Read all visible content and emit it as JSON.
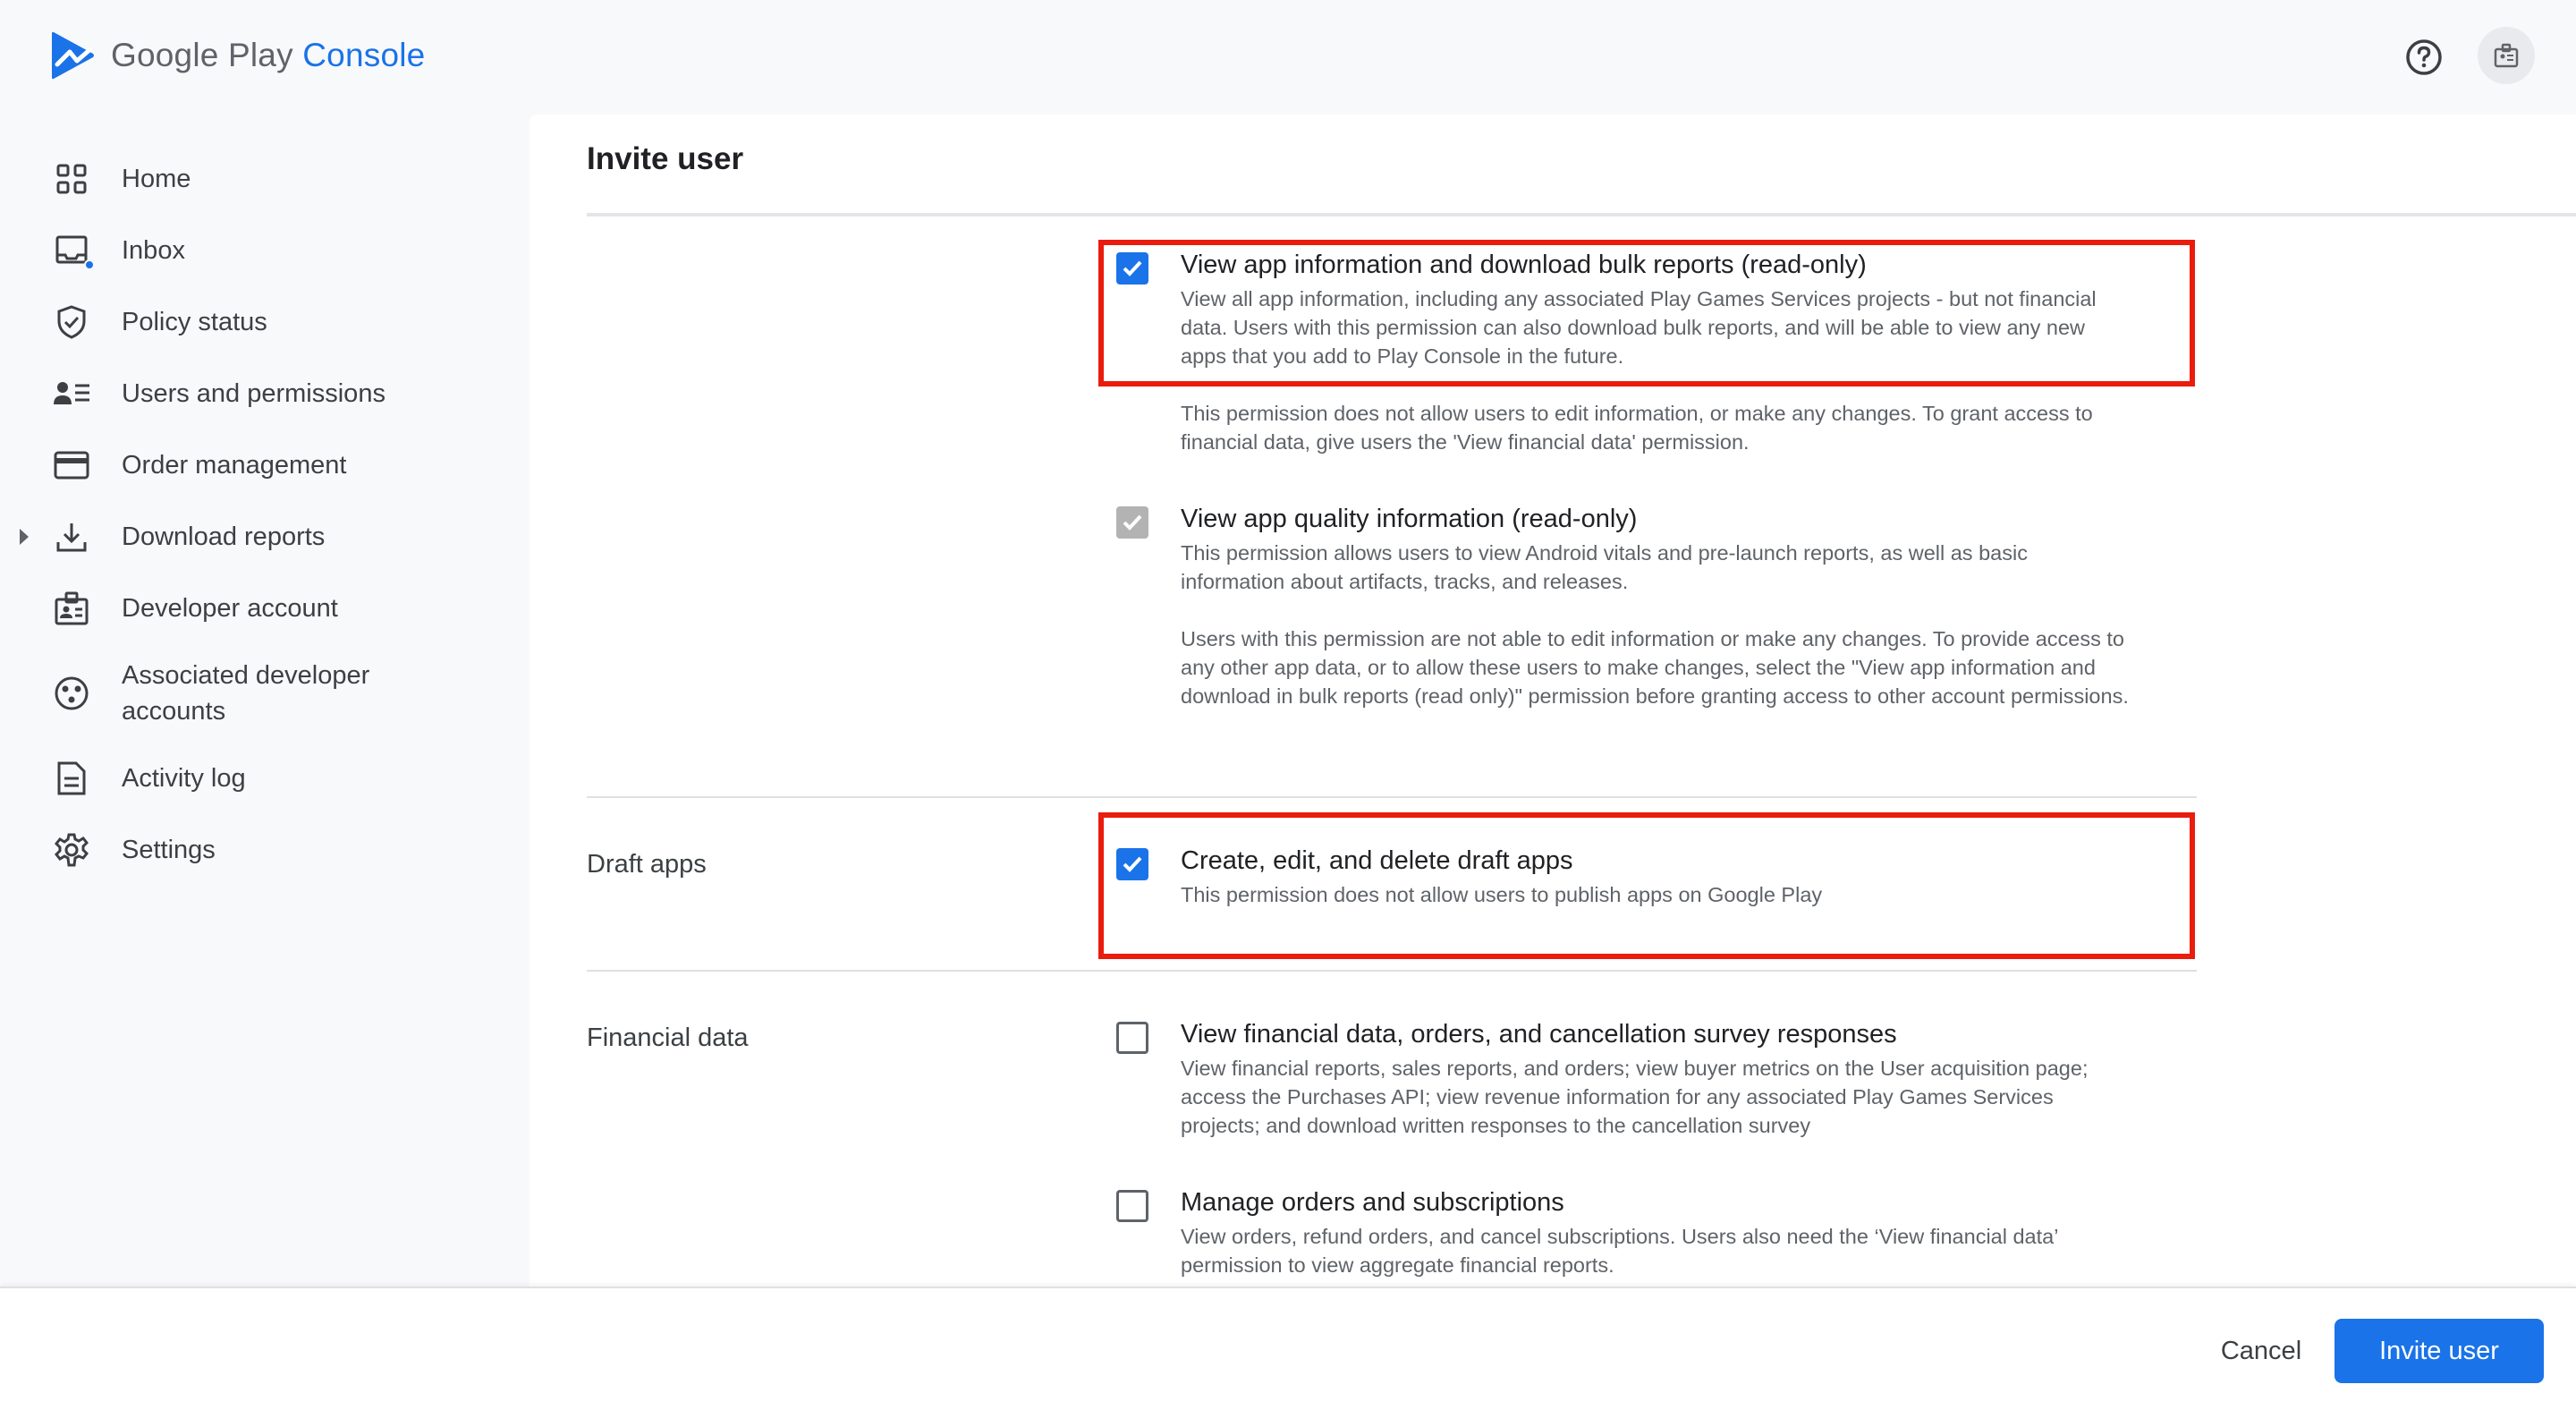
{
  "header": {
    "logo_primary": "Google Play",
    "logo_secondary": "Console",
    "help_icon": "help-circle-icon",
    "account_icon": "developer-badge-icon"
  },
  "sidebar": {
    "items": [
      {
        "label": "Home",
        "icon": "grid-icon"
      },
      {
        "label": "Inbox",
        "icon": "inbox-icon"
      },
      {
        "label": "Policy status",
        "icon": "shield-check-icon"
      },
      {
        "label": "Users and permissions",
        "icon": "users-list-icon"
      },
      {
        "label": "Order management",
        "icon": "credit-card-icon"
      },
      {
        "label": "Download reports",
        "icon": "download-icon"
      },
      {
        "label": "Developer account",
        "icon": "id-badge-icon"
      },
      {
        "label": "Associated developer accounts",
        "icon": "linked-accounts-icon"
      },
      {
        "label": "Activity log",
        "icon": "document-icon"
      },
      {
        "label": "Settings",
        "icon": "gear-icon"
      }
    ]
  },
  "main": {
    "title": "Invite user",
    "sections": {
      "draft_apps": "Draft apps",
      "financial_data": "Financial data"
    },
    "permissions": {
      "view_app_info": {
        "title": "View app information and download bulk reports (read-only)",
        "desc": "View all app information, including any associated Play Games Services projects - but not financial data. Users with this permission can also download bulk reports, and will be able to view any new apps that you add to Play Console in the future.",
        "note": "This permission does not allow users to edit information, or make any changes. To grant access to financial data, give users the 'View financial data' permission.",
        "checked": true
      },
      "view_quality": {
        "title": "View app quality information (read-only)",
        "desc": "This permission allows users to view Android vitals and pre-launch reports, as well as basic information about artifacts, tracks, and releases.",
        "note": "Users with this permission are not able to edit information or make any changes. To provide access to any other app data, or to allow these users to make changes, select the \"View app information and download in bulk reports (read only)\" permission before granting access to other account permissions.",
        "checked": true,
        "disabled": true
      },
      "draft_apps": {
        "title": "Create, edit, and delete draft apps",
        "desc": "This permission does not allow users to publish apps on Google Play",
        "checked": true
      },
      "financial": {
        "title": "View financial data, orders, and cancellation survey responses",
        "desc": "View financial reports, sales reports, and orders; view buyer metrics on the User acquisition page; access the Purchases API; view revenue information for any associated Play Games Services projects; and download written responses to the cancellation survey",
        "checked": false
      },
      "orders": {
        "title": "Manage orders and subscriptions",
        "desc": "View orders, refund orders, and cancel subscriptions. Users also need the ‘View financial data’ permission to view aggregate financial reports.",
        "checked": false
      }
    }
  },
  "footer": {
    "cancel_label": "Cancel",
    "invite_label": "Invite user"
  },
  "colors": {
    "accent": "#1a73e8",
    "highlight": "#ea1c0d"
  }
}
